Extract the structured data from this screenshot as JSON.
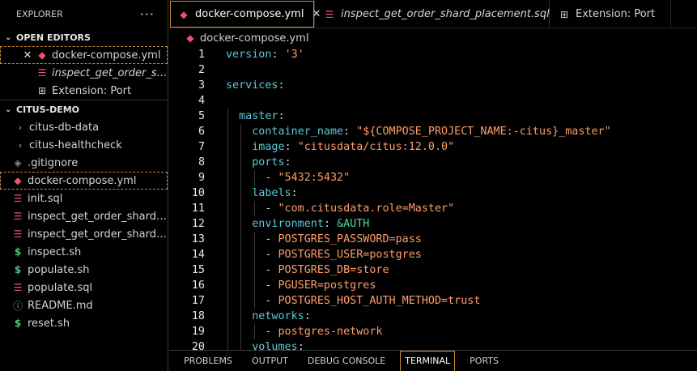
{
  "sidebar": {
    "title": "EXPLORER",
    "more": "···",
    "open_editors": {
      "title": "OPEN EDITORS",
      "items": [
        {
          "label": "docker-compose.yml",
          "icon": "docker-icon"
        },
        {
          "label": "inspect_get_order_shard_placement.sql",
          "icon": "database-icon"
        },
        {
          "label": "Extension: Port",
          "icon": "extension-icon"
        }
      ]
    },
    "project": {
      "title": "CITUS-DEMO",
      "items": [
        {
          "label": "citus-db-data",
          "type": "folder"
        },
        {
          "label": "citus-healthcheck",
          "type": "folder"
        },
        {
          "label": ".gitignore",
          "icon": "git-icon"
        },
        {
          "label": "docker-compose.yml",
          "icon": "docker-icon"
        },
        {
          "label": "init.sql",
          "icon": "database-icon"
        },
        {
          "label": "inspect_get_order_shard_placement.sql",
          "icon": "database-icon"
        },
        {
          "label": "inspect_get_order_shard_table.sql",
          "icon": "database-icon"
        },
        {
          "label": "inspect.sh",
          "icon": "shell-icon"
        },
        {
          "label": "populate.sh",
          "icon": "shell-icon"
        },
        {
          "label": "populate.sql",
          "icon": "database-icon"
        },
        {
          "label": "README.md",
          "icon": "info-icon"
        },
        {
          "label": "reset.sh",
          "icon": "shell-icon"
        }
      ]
    }
  },
  "tabs": [
    {
      "label": "docker-compose.yml",
      "icon": "docker-icon"
    },
    {
      "label": "inspect_get_order_shard_placement.sql",
      "icon": "database-icon"
    },
    {
      "label": "Extension: Port",
      "icon": "extension-icon"
    }
  ],
  "breadcrumb": "docker-compose.yml",
  "editor": {
    "lines": [
      {
        "n": "1",
        "segs": [
          [
            "k",
            "version"
          ],
          [
            "p",
            ": "
          ],
          [
            "s",
            "'3'"
          ]
        ]
      },
      {
        "n": "2",
        "segs": []
      },
      {
        "n": "3",
        "segs": [
          [
            "k",
            "services"
          ],
          [
            "p",
            ":"
          ]
        ]
      },
      {
        "n": "4",
        "segs": []
      },
      {
        "n": "5",
        "segs": [
          [
            "p",
            "  "
          ],
          [
            "k",
            "master"
          ],
          [
            "p",
            ":"
          ]
        ]
      },
      {
        "n": "6",
        "segs": [
          [
            "p",
            "    "
          ],
          [
            "k",
            "container_name"
          ],
          [
            "p",
            ": "
          ],
          [
            "s",
            "\"${COMPOSE_PROJECT_NAME:-citus}_master\""
          ]
        ]
      },
      {
        "n": "7",
        "segs": [
          [
            "p",
            "    "
          ],
          [
            "k",
            "image"
          ],
          [
            "p",
            ": "
          ],
          [
            "s",
            "\"citusdata/citus:12.0.0\""
          ]
        ]
      },
      {
        "n": "8",
        "segs": [
          [
            "p",
            "    "
          ],
          [
            "k",
            "ports"
          ],
          [
            "p",
            ":"
          ]
        ]
      },
      {
        "n": "9",
        "segs": [
          [
            "p",
            "      - "
          ],
          [
            "s",
            "\"5432:5432\""
          ]
        ]
      },
      {
        "n": "10",
        "segs": [
          [
            "p",
            "    "
          ],
          [
            "k",
            "labels"
          ],
          [
            "p",
            ":"
          ]
        ]
      },
      {
        "n": "11",
        "segs": [
          [
            "p",
            "      - "
          ],
          [
            "s",
            "\"com.citusdata.role=Master\""
          ]
        ]
      },
      {
        "n": "12",
        "segs": [
          [
            "p",
            "    "
          ],
          [
            "k",
            "environment"
          ],
          [
            "p",
            ": "
          ],
          [
            "a",
            "&AUTH"
          ]
        ]
      },
      {
        "n": "13",
        "segs": [
          [
            "p",
            "      - "
          ],
          [
            "s",
            "POSTGRES_PASSWORD=pass"
          ]
        ]
      },
      {
        "n": "14",
        "segs": [
          [
            "p",
            "      - "
          ],
          [
            "s",
            "POSTGRES_USER=postgres"
          ]
        ]
      },
      {
        "n": "15",
        "segs": [
          [
            "p",
            "      - "
          ],
          [
            "s",
            "POSTGRES_DB=store"
          ]
        ]
      },
      {
        "n": "16",
        "segs": [
          [
            "p",
            "      - "
          ],
          [
            "s",
            "PGUSER=postgres"
          ]
        ]
      },
      {
        "n": "17",
        "segs": [
          [
            "p",
            "      - "
          ],
          [
            "s",
            "POSTGRES_HOST_AUTH_METHOD=trust"
          ]
        ]
      },
      {
        "n": "18",
        "segs": [
          [
            "p",
            "    "
          ],
          [
            "k",
            "networks"
          ],
          [
            "p",
            ":"
          ]
        ]
      },
      {
        "n": "19",
        "segs": [
          [
            "p",
            "      - "
          ],
          [
            "s",
            "postgres-network"
          ]
        ]
      },
      {
        "n": "20",
        "segs": [
          [
            "p",
            "    "
          ],
          [
            "k",
            "volumes"
          ],
          [
            "p",
            ":"
          ]
        ]
      }
    ]
  },
  "panel": {
    "tabs": [
      "PROBLEMS",
      "OUTPUT",
      "DEBUG CONSOLE",
      "TERMINAL",
      "PORTS"
    ],
    "active": "TERMINAL"
  },
  "colors": {
    "accent_outline": "#c98a3b",
    "key": "#5fc7d9",
    "string": "#ff9d6a",
    "anchor": "#4ed6a0"
  }
}
